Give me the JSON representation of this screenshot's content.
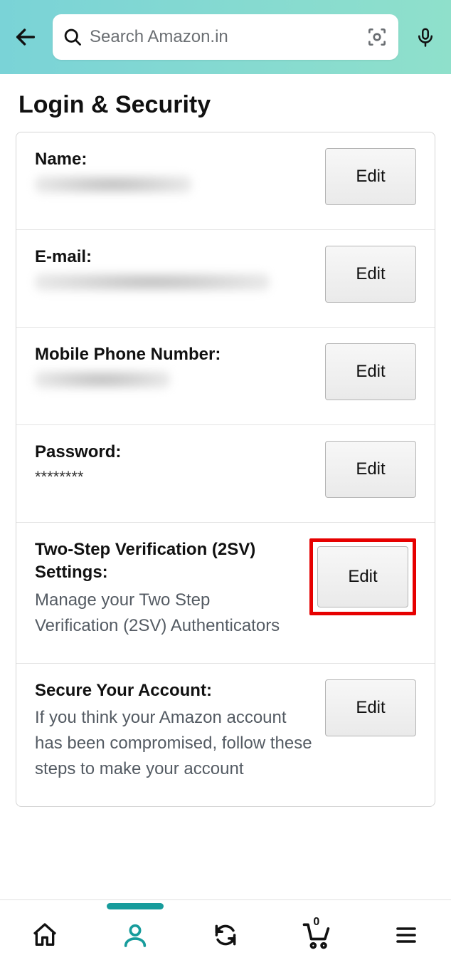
{
  "header": {
    "search_placeholder": "Search Amazon.in"
  },
  "page": {
    "title": "Login & Security"
  },
  "rows": {
    "name": {
      "label": "Name:",
      "edit": "Edit"
    },
    "email": {
      "label": "E-mail:",
      "edit": "Edit"
    },
    "mobile": {
      "label": "Mobile Phone Number:",
      "edit": "Edit"
    },
    "password": {
      "label": "Password:",
      "value": "********",
      "edit": "Edit"
    },
    "twosv": {
      "label": "Two-Step Verification (2SV) Settings:",
      "desc": "Manage your Two Step Verification (2SV) Authenticators",
      "edit": "Edit"
    },
    "secure": {
      "label": "Secure Your Account:",
      "desc": "If you think your Amazon account has been compromised, follow these steps to make your account",
      "edit": "Edit"
    }
  },
  "bottom_nav": {
    "cart_count": "0"
  }
}
